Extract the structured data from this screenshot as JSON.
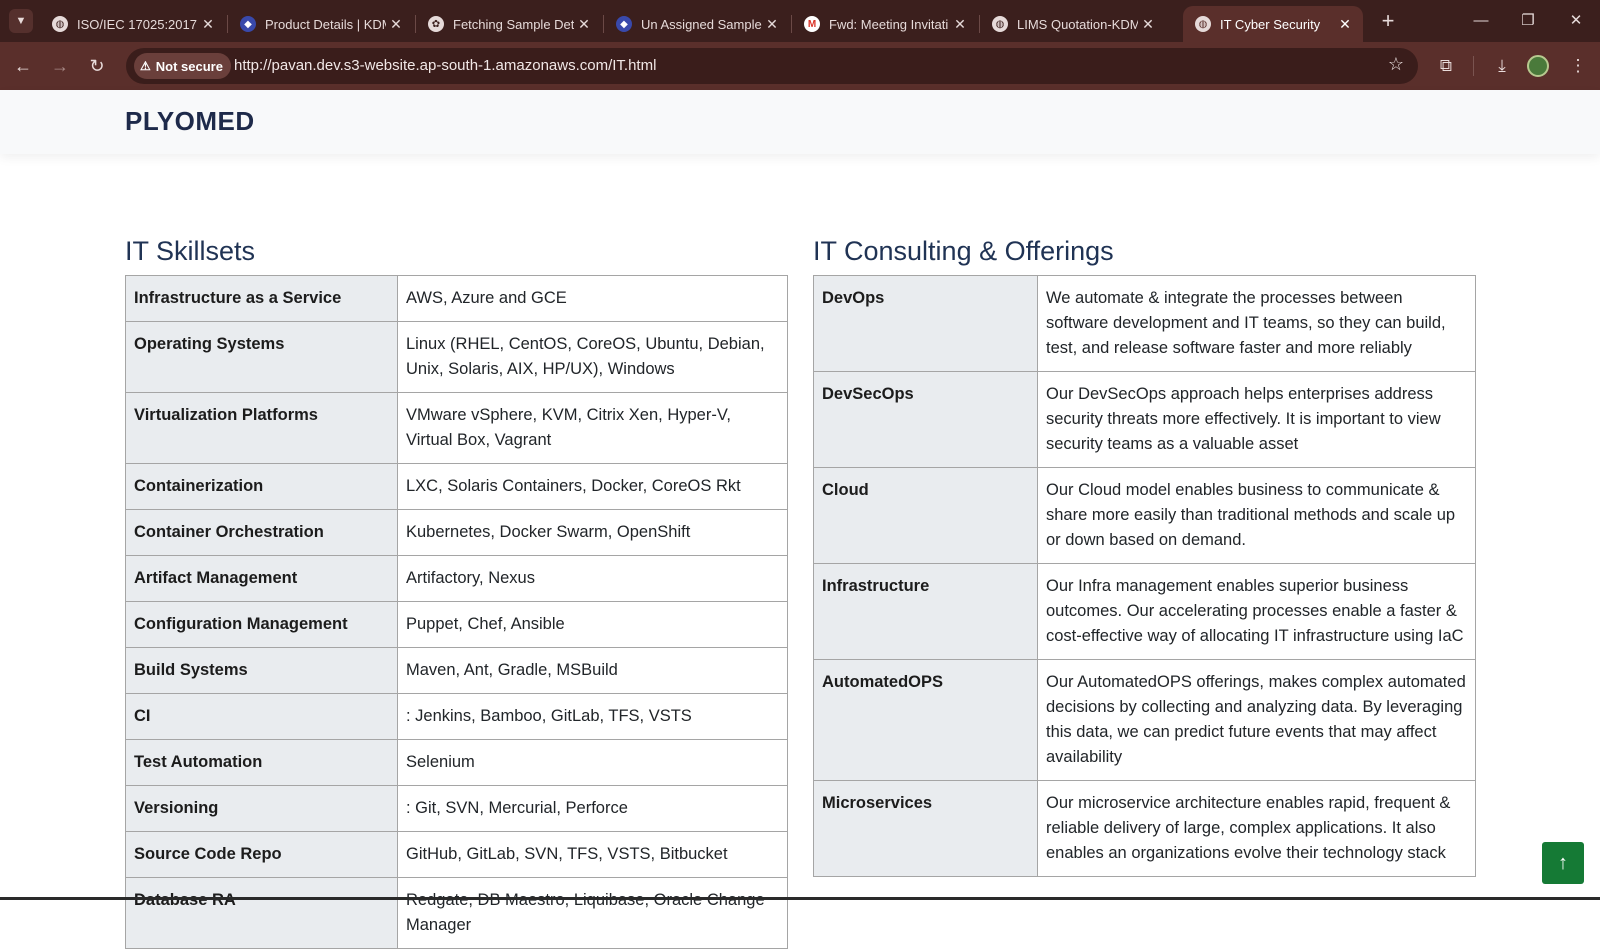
{
  "browser": {
    "tabs": [
      {
        "title": "ISO/IEC 17025:2017",
        "favicon": "globe-icon",
        "active": false
      },
      {
        "title": "Product Details | KDM",
        "favicon": "kdm-logo-icon",
        "active": false
      },
      {
        "title": "Fetching Sample Deta",
        "favicon": "openai-icon",
        "active": false
      },
      {
        "title": "Un Assigned Samples",
        "favicon": "kdm-logo-icon",
        "active": false
      },
      {
        "title": "Fwd: Meeting Invitati",
        "favicon": "gmail-icon",
        "active": false
      },
      {
        "title": "LIMS Quotation-KDM",
        "favicon": "globe-icon",
        "active": false
      },
      {
        "title": "IT Cyber Security",
        "favicon": "globe-icon",
        "active": true
      }
    ],
    "security_label": "Not secure",
    "url": "http://pavan.dev.s3-website.ap-south-1.amazonaws.com/IT.html"
  },
  "site": {
    "brand": "PLYOMED"
  },
  "skillsets": {
    "heading": "IT Skillsets",
    "rows": [
      {
        "key": "Infrastructure as a Service",
        "value": "AWS, Azure and GCE"
      },
      {
        "key": "Operating Systems",
        "value": "Linux (RHEL, CentOS, CoreOS, Ubuntu, Debian, Unix, Solaris, AIX, HP/UX), Windows"
      },
      {
        "key": "Virtualization Platforms",
        "value": "VMware vSphere, KVM, Citrix Xen, Hyper-V, Virtual Box, Vagrant"
      },
      {
        "key": "Containerization",
        "value": "LXC, Solaris Containers, Docker, CoreOS Rkt"
      },
      {
        "key": "Container Orchestration",
        "value": "Kubernetes, Docker Swarm, OpenShift"
      },
      {
        "key": "Artifact Management",
        "value": "Artifactory, Nexus"
      },
      {
        "key": "Configuration Management",
        "value": "Puppet, Chef, Ansible"
      },
      {
        "key": "Build Systems",
        "value": "Maven, Ant, Gradle, MSBuild"
      },
      {
        "key": "CI",
        "value": ": Jenkins, Bamboo, GitLab, TFS, VSTS"
      },
      {
        "key": "Test Automation",
        "value": "Selenium"
      },
      {
        "key": "Versioning",
        "value": ": Git, SVN, Mercurial, Perforce"
      },
      {
        "key": "Source Code Repo",
        "value": "GitHub, GitLab, SVN, TFS, VSTS, Bitbucket"
      },
      {
        "key": "Database RA",
        "value": "Redgate, DB Maestro, Liquibase, Oracle Change Manager"
      }
    ]
  },
  "offerings": {
    "heading": "IT Consulting & Offerings",
    "rows": [
      {
        "key": "DevOps",
        "value": "We automate & integrate the processes between software development and IT teams, so they can build, test, and release software faster and more reliably"
      },
      {
        "key": "DevSecOps",
        "value": "Our DevSecOps approach helps enterprises address security threats more effectively. It is important to view security teams as a valuable asset"
      },
      {
        "key": "Cloud",
        "value": "Our Cloud model enables business to communicate & share more easily than traditional methods and scale up or down based on demand."
      },
      {
        "key": "Infrastructure",
        "value": "Our Infra management enables superior business outcomes. Our accelerating processes enable a faster & cost-effective way of allocating IT infrastructure using IaC"
      },
      {
        "key": "AutomatedOPS",
        "value": "Our AutomatedOPS offerings, makes complex automated decisions by collecting and analyzing data. By leveraging this data, we can predict future events that may affect availability"
      },
      {
        "key": "Microservices",
        "value": "Our microservice architecture enables rapid, frequent & reliable delivery of large, complex applications. It also enables an organizations evolve their technology stack"
      }
    ]
  },
  "colors": {
    "tabstrip": "#3b1f1d",
    "toolbar": "#5a2f2b",
    "heading": "#203354",
    "key_cell": "#e9ecef",
    "scroll_button": "#157a35"
  }
}
